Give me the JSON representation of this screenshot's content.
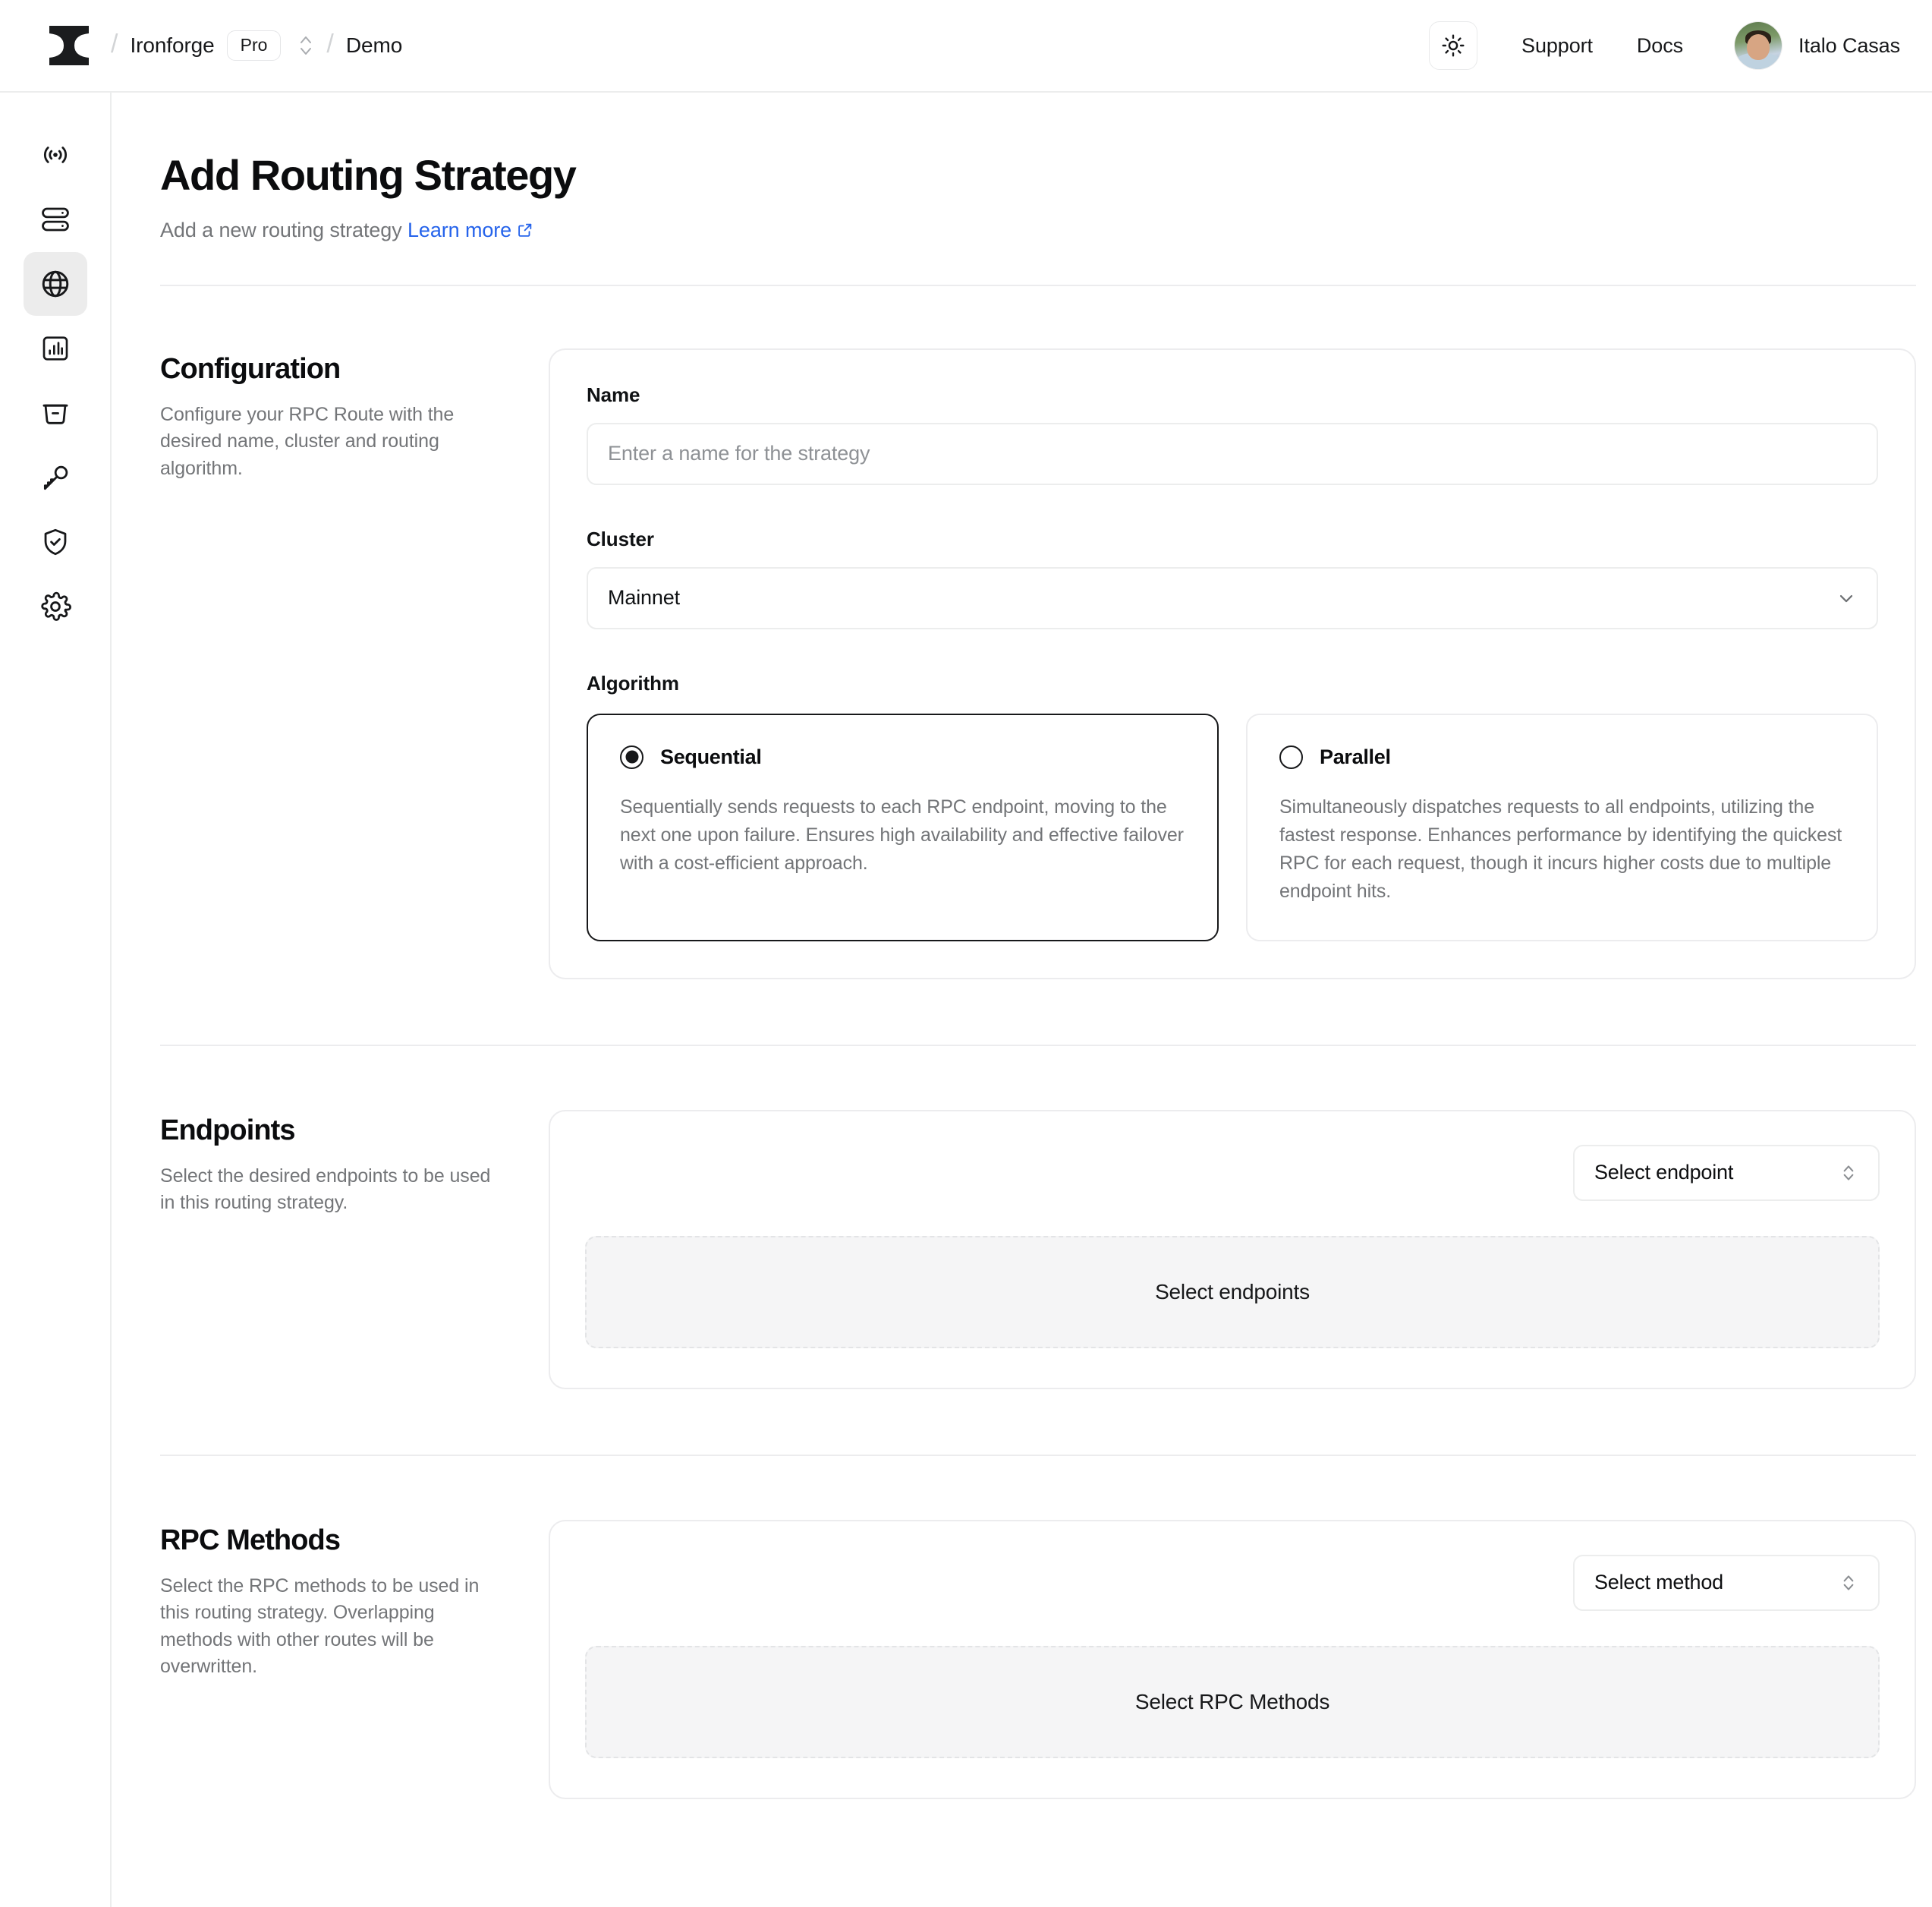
{
  "topbar": {
    "logo_name": "ironforge-anvil-logo",
    "breadcrumb": {
      "separator": "/",
      "org": "Ironforge",
      "plan_badge": "Pro",
      "project": "Demo"
    },
    "theme_toggle_icon": "sun-icon",
    "links": [
      {
        "label": "Support"
      },
      {
        "label": "Docs"
      }
    ],
    "user": {
      "name": "Italo Casas"
    }
  },
  "sidebar": {
    "items": [
      {
        "name": "sidebar-item-broadcast",
        "icon": "broadcast-icon",
        "active": false
      },
      {
        "name": "sidebar-item-nodes",
        "icon": "server-stack-icon",
        "active": false
      },
      {
        "name": "sidebar-item-routing",
        "icon": "globe-icon",
        "active": true
      },
      {
        "name": "sidebar-item-analytics",
        "icon": "bar-chart-icon",
        "active": false
      },
      {
        "name": "sidebar-item-archive",
        "icon": "archive-icon",
        "active": false
      },
      {
        "name": "sidebar-item-api-keys",
        "icon": "key-icon",
        "active": false
      },
      {
        "name": "sidebar-item-security",
        "icon": "shield-check-icon",
        "active": false
      },
      {
        "name": "sidebar-item-settings",
        "icon": "gear-icon",
        "active": false
      }
    ]
  },
  "page": {
    "title": "Add Routing Strategy",
    "subtitle": "Add a new routing strategy",
    "learn_more": "Learn more",
    "learn_more_icon": "external-link-icon"
  },
  "configuration": {
    "title": "Configuration",
    "description": "Configure your RPC Route with the desired name, cluster and routing algorithm.",
    "name_field": {
      "label": "Name",
      "value": "",
      "placeholder": "Enter a name for the strategy"
    },
    "cluster_field": {
      "label": "Cluster",
      "value": "Mainnet",
      "chevron_icon": "chevron-down-icon"
    },
    "algorithm": {
      "label": "Algorithm",
      "options": [
        {
          "id": "sequential",
          "title": "Sequential",
          "description": "Sequentially sends requests to each RPC endpoint, moving to the next one upon failure. Ensures high availability and effective failover with a cost-efficient approach.",
          "selected": true
        },
        {
          "id": "parallel",
          "title": "Parallel",
          "description": "Simultaneously dispatches requests to all endpoints, utilizing the fastest response. Enhances performance by identifying the quickest RPC for each request, though it incurs higher costs due to multiple endpoint hits.",
          "selected": false
        }
      ]
    }
  },
  "endpoints": {
    "title": "Endpoints",
    "description": "Select the desired endpoints to be used in this routing strategy.",
    "select_label": "Select endpoint",
    "select_icon": "chevron-up-down-icon",
    "dropzone_label": "Select endpoints"
  },
  "rpc_methods": {
    "title": "RPC Methods",
    "description": "Select the RPC methods to be used in this routing strategy. Overlapping methods with other routes will be overwritten.",
    "select_label": "Select method",
    "select_icon": "chevron-up-down-icon",
    "dropzone_label": "Select RPC Methods"
  },
  "colors": {
    "accent_link": "#2563eb",
    "text_primary": "#0b0c0e",
    "text_muted": "#737578",
    "border": "#ececee",
    "active_sidebar_bg": "#ececec",
    "dropzone_bg": "#f5f5f6"
  }
}
